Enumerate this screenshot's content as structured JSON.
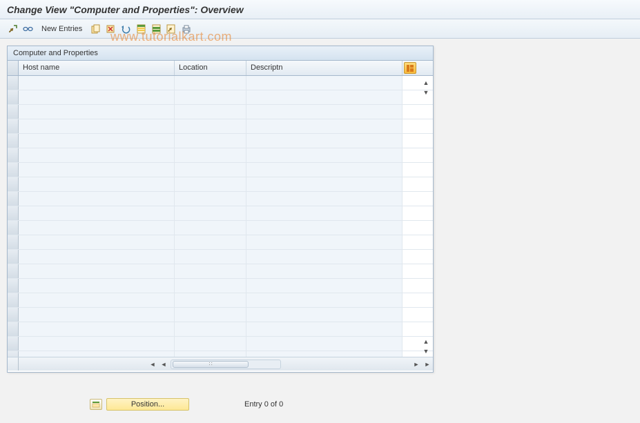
{
  "title": "Change View \"Computer and Properties\": Overview",
  "watermark": "www.tutorialkart.com",
  "toolbar": {
    "new_entries_label": "New Entries"
  },
  "panel": {
    "title": "Computer and Properties",
    "columns": {
      "host_name": "Host name",
      "location": "Location",
      "description": "Descriptn"
    }
  },
  "footer": {
    "position_label": "Position...",
    "entry_text": "Entry 0 of 0"
  },
  "icons": {
    "toggle": "toggle-display-icon",
    "glasses": "other-view-icon",
    "copy": "copy-icon",
    "delete": "delete-icon",
    "undo": "undo-icon",
    "select_all": "select-all-icon",
    "select_block": "select-block-icon",
    "deselect": "deselect-icon",
    "print": "print-icon"
  }
}
